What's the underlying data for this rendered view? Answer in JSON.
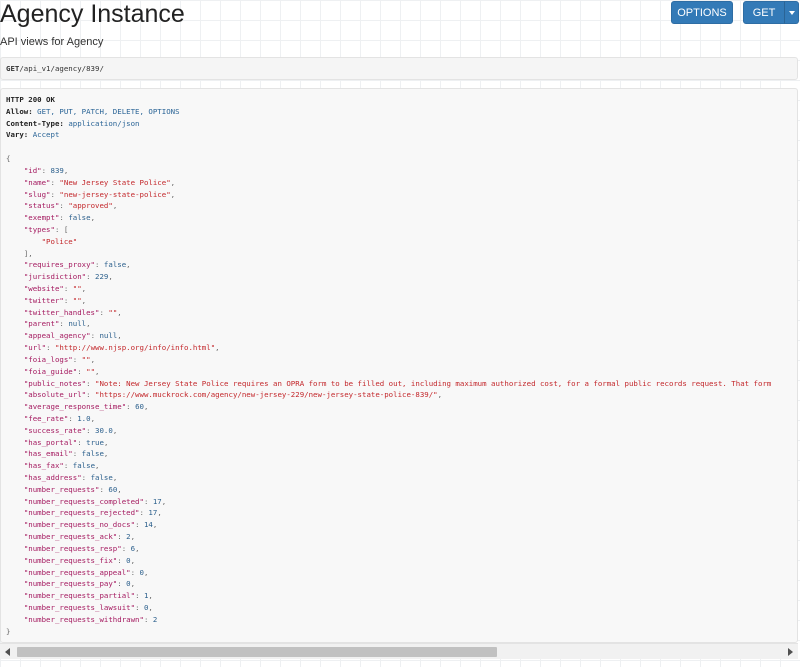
{
  "header": {
    "title": "Agency Instance",
    "description": "API views for Agency",
    "options_label": "OPTIONS",
    "get_label": "GET"
  },
  "request": {
    "method": "GET",
    "path": "/api_v1/agency/839/"
  },
  "response": {
    "status": "HTTP 200 OK",
    "headers": [
      {
        "key": "Allow:",
        "value": "GET, PUT, PATCH, DELETE, OPTIONS"
      },
      {
        "key": "Content-Type:",
        "value": "application/json"
      },
      {
        "key": "Vary:",
        "value": "Accept"
      }
    ],
    "body": {
      "id": "839",
      "name": "\"New Jersey State Police\"",
      "slug": "\"new-jersey-state-police\"",
      "status": "\"approved\"",
      "exempt": "false",
      "types_0": "\"Police\"",
      "requires_proxy": "false",
      "jurisdiction": "229",
      "website": "\"\"",
      "twitter": "\"\"",
      "twitter_handles": "\"\"",
      "parent": "null",
      "appeal_agency": "null",
      "url": "\"http://www.njsp.org/info/info.html\"",
      "foia_logs": "\"\"",
      "foia_guide": "\"\"",
      "public_notes": "\"Note: New Jersey State Police requires an OPRA form to be filled out, including maximum authorized cost, for a formal public records request. That form",
      "absolute_url": "\"https://www.muckrock.com/agency/new-jersey-229/new-jersey-state-police-839/\"",
      "average_response_time": "60",
      "fee_rate": "1.0",
      "success_rate": "30.0",
      "has_portal": "true",
      "has_email": "false",
      "has_fax": "false",
      "has_address": "false",
      "number_requests": "60",
      "number_requests_completed": "17",
      "number_requests_rejected": "17",
      "number_requests_no_docs": "14",
      "number_requests_ack": "2",
      "number_requests_resp": "6",
      "number_requests_fix": "0",
      "number_requests_appeal": "0",
      "number_requests_pay": "0",
      "number_requests_partial": "1",
      "number_requests_lawsuit": "0",
      "number_requests_withdrawn": "2"
    }
  }
}
